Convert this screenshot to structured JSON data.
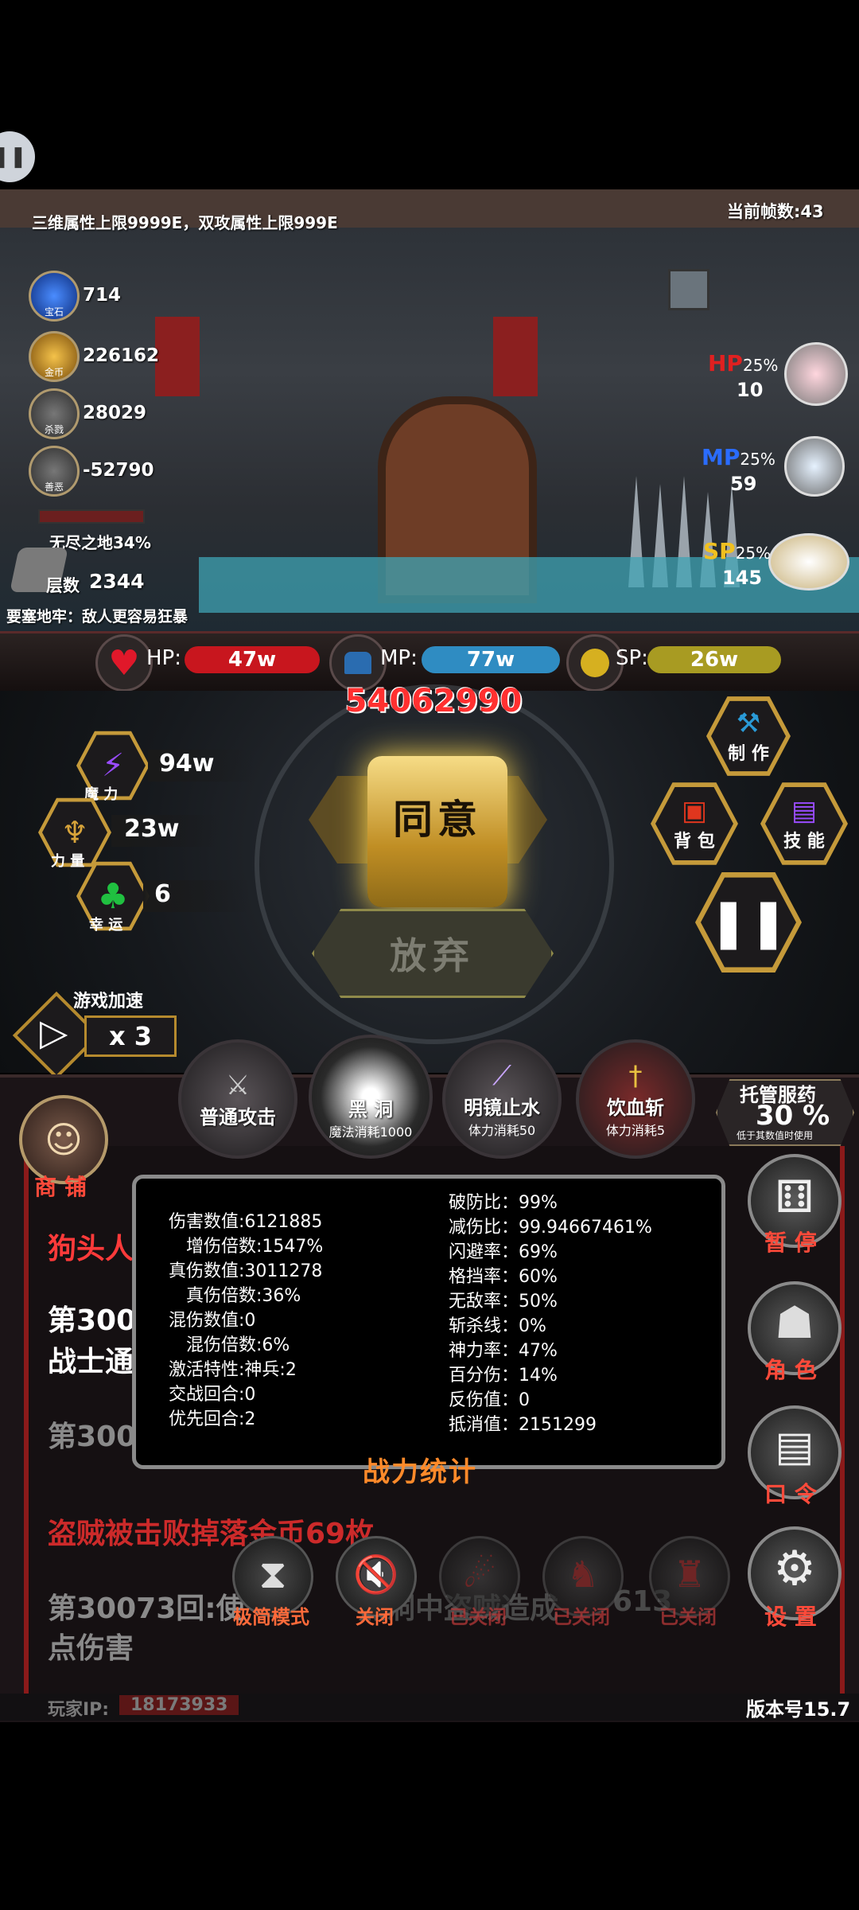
{
  "header": {
    "notice": "三维属性上限9999E，双攻属性上限999E",
    "fps": "当前帧数:43"
  },
  "resources": [
    {
      "icon": "gem-icon",
      "label": "宝石",
      "value": "714"
    },
    {
      "icon": "gold-coin-icon",
      "label": "金币",
      "value": "226162"
    },
    {
      "icon": "skull-icon",
      "label": "杀戮",
      "value": "28029"
    },
    {
      "icon": "mask-icon",
      "label": "善恶",
      "value": "-52790"
    }
  ],
  "stage": {
    "name": "无尽之地34%",
    "layer_label": "层数",
    "layer_value": "2344"
  },
  "dungeon_note": "要塞地牢：敌人更容易狂暴",
  "potions": [
    {
      "key": "HP",
      "pct": "25%",
      "count": "10",
      "color": "#e02020"
    },
    {
      "key": "MP",
      "pct": "25%",
      "count": "59",
      "color": "#2a6cff"
    },
    {
      "key": "SP",
      "pct": "25%",
      "count": "145",
      "color": "#f0c020"
    }
  ],
  "bars": {
    "hp_label": "HP:",
    "hp_value": "47w",
    "mp_label": "MP:",
    "mp_value": "77w",
    "sp_label": "SP:",
    "sp_value": "26w"
  },
  "power_number": "54062990",
  "attrs": [
    {
      "label": "魔 力",
      "value": "94w"
    },
    {
      "label": "力 量",
      "value": "23w"
    },
    {
      "label": "幸 运",
      "value": "6"
    }
  ],
  "dialog": {
    "agree": "同意",
    "abandon": "放弃"
  },
  "right_hex": [
    {
      "label": "制 作"
    },
    {
      "label": "背 包"
    },
    {
      "label": "技 能"
    }
  ],
  "speed": {
    "label": "游戏加速",
    "value": "x 3"
  },
  "skills": [
    {
      "name": "普通攻击",
      "sub": ""
    },
    {
      "name": "黑 洞",
      "sub": "魔法消耗1000"
    },
    {
      "name": "明镜止水",
      "sub": "体力消耗50"
    },
    {
      "name": "饮血斩",
      "sub": "体力消耗5"
    }
  ],
  "auto_potion": {
    "title": "托管服药",
    "value": "30 %",
    "note": "低于其数值时使用"
  },
  "shop_label": "商 铺",
  "side_buttons": [
    {
      "label": "暂 停"
    },
    {
      "label": "角 色"
    },
    {
      "label": "口 令"
    },
    {
      "label": "设 置"
    }
  ],
  "log": {
    "line1": "狗头人",
    "line2": "第300",
    "line3": "战士通",
    "line4": "第300",
    "line5": "盗贼被击败掉落金币69枚",
    "line6": "第30073回:使",
    "line6b": "黑洞中盗贼造成",
    "line6c": "613",
    "line7": "点伤害"
  },
  "stats_panel": {
    "title": "战力统计",
    "left": [
      "伤害数值:6121885",
      "增伤倍数:1547%",
      "真伤数值:3011278",
      "真伤倍数:36%",
      "混伤数值:0",
      "混伤倍数:6%",
      "激活特性:神兵:2",
      "交战回合:0",
      "优先回合:2"
    ],
    "right": [
      "破防比：99%",
      "减伤比：99.94667461%",
      "闪避率：69%",
      "格挡率：60%",
      "无敌率：50%",
      "斩杀线：0%",
      "神力率：47%",
      "百分伤：14%",
      "反伤值：0",
      "抵消值：2151299"
    ]
  },
  "bottom_bar": [
    {
      "label": "极简模式",
      "color": "#ff6a3a"
    },
    {
      "label": "关闭",
      "color": "#ff6a3a"
    },
    {
      "label": "已关闭",
      "color": "#c03a3a"
    },
    {
      "label": "已关闭",
      "color": "#c03a3a"
    },
    {
      "label": "已关闭",
      "color": "#c03a3a"
    }
  ],
  "footer": {
    "ip_label": "玩家IP:",
    "ip_value": "18173933",
    "version": "版本号15.7"
  }
}
